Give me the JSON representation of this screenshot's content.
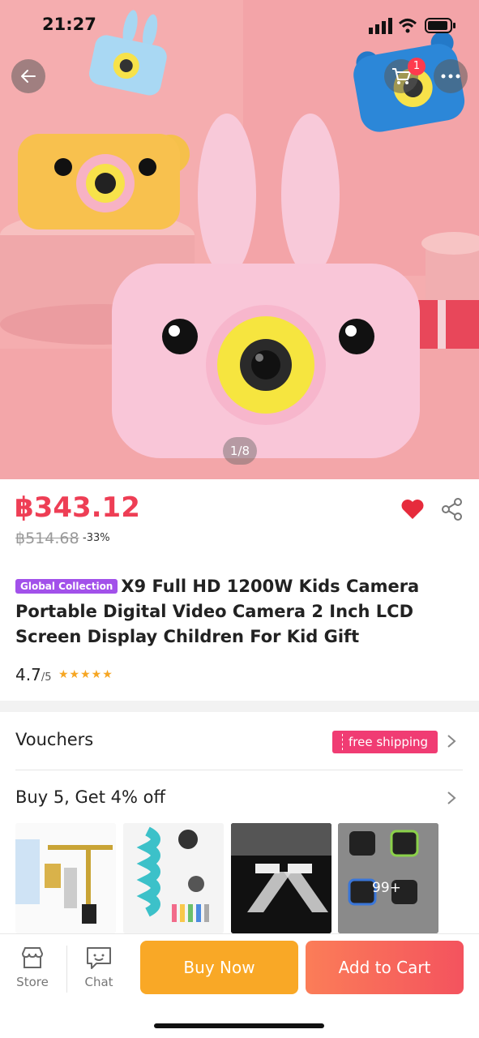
{
  "status_bar": {
    "time": "21:27"
  },
  "header": {
    "cart_count": "1"
  },
  "gallery": {
    "pager": "1/8"
  },
  "product": {
    "price": "฿343.12",
    "original_price": "฿514.68",
    "discount": "-33%",
    "tag": "Global Collection",
    "title": "X9 Full HD 1200W Kids Camera Portable Digital Video Camera 2 Inch LCD Screen Display Children For Kid Gift",
    "rating": "4.7",
    "rating_scale": "/5",
    "stars": "★★★★★"
  },
  "vouchers": {
    "label": "Vouchers",
    "ticket": "free shipping"
  },
  "bundle": {
    "label": "Buy 5, Get 4% off",
    "more_count": "99+"
  },
  "bottom_bar": {
    "store": "Store",
    "chat": "Chat",
    "buy_now": "Buy Now",
    "add_to_cart": "Add to Cart"
  },
  "colors": {
    "price": "#ee3e55",
    "buy_now": "#f9a826",
    "add_to_cart": "#f4535e",
    "tag": "#a251ea",
    "ticket": "#f03c73"
  }
}
